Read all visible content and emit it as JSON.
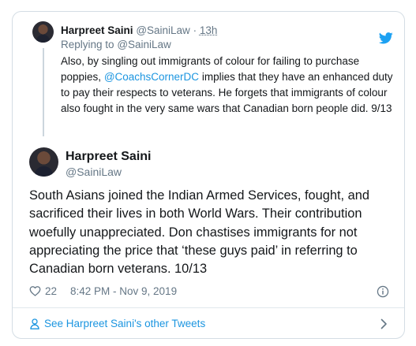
{
  "parent_tweet": {
    "author_name": "Harpreet Saini",
    "author_handle": "@SainiLaw",
    "separator": "·",
    "time": "13h",
    "replying_prefix": "Replying to",
    "replying_handle": "@SainiLaw",
    "text_before_mention": "Also, by singling out immigrants of colour for failing to purchase poppies,",
    "mention": "@CoachsCornerDC",
    "text_after_mention": "implies that they have an enhanced duty to pay their respects to veterans.  He forgets that immigrants of colour also fought in the very same wars that Canadian born people did.  9/13"
  },
  "main_tweet": {
    "author_name": "Harpreet Saini",
    "author_handle": "@SainiLaw",
    "text": "South Asians joined the Indian Armed Services, fought, and sacrificed their lives in both World Wars.  Their contribution woefully unappreciated.  Don chastises immigrants for not appreciating the price that ‘these guys paid’ in referring to Canadian born veterans.  10/13",
    "like_count": "22",
    "timestamp": "8:42 PM - Nov 9, 2019"
  },
  "footer": {
    "link_text": "See Harpreet Saini's other Tweets"
  },
  "icons": {
    "brand": "twitter-bird-icon",
    "like": "heart-icon",
    "info": "info-icon",
    "profile": "person-icon",
    "next": "chevron-right-icon"
  },
  "colors": {
    "accent": "#1da1f2",
    "link": "#1b95e0",
    "muted_text": "#657786",
    "border": "#d4dde4"
  }
}
